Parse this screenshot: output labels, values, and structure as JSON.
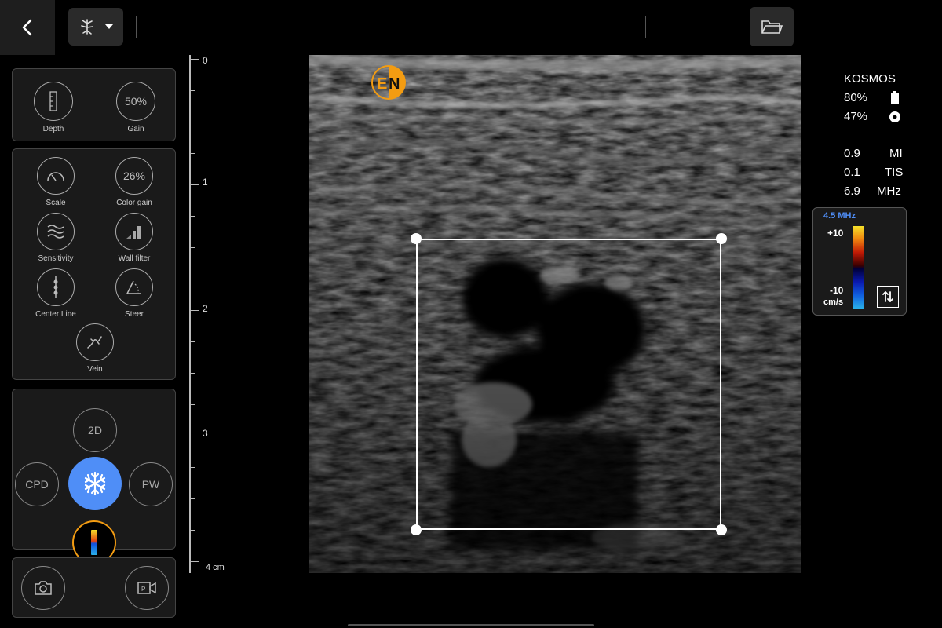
{
  "top_bar": {
    "back_icon": "chevron-left-icon",
    "preset_icon": "vascular-preset-icon",
    "folder_icon": "folder-icon"
  },
  "panel1": {
    "depth": {
      "label": "Depth",
      "icon": "ruler-icon"
    },
    "gain": {
      "label": "Gain",
      "value": "50%"
    }
  },
  "panel2": {
    "scale": {
      "label": "Scale",
      "icon": "gauge-icon"
    },
    "color_gain": {
      "label": "Color gain",
      "value": "26%"
    },
    "sensitivity": {
      "label": "Sensitivity",
      "icon": "waves-icon"
    },
    "wall_filter": {
      "label": "Wall filter",
      "icon": "signal-bars-icon"
    },
    "center_line": {
      "label": "Center Line",
      "icon": "center-line-icon"
    },
    "steer": {
      "label": "Steer",
      "icon": "steer-angle-icon"
    },
    "vein": {
      "label": "Vein",
      "icon": "vein-icon"
    }
  },
  "modes": {
    "mode_2d": "2D",
    "cpd": "CPD",
    "pw": "PW",
    "freeze_icon": "snowflake-icon",
    "color_icon": "color-doppler-icon"
  },
  "capture": {
    "camera_icon": "camera-icon",
    "video_icon": "video-record-icon"
  },
  "depth_scale": {
    "ticks": [
      "0",
      "1",
      "2",
      "3",
      "4 cm"
    ]
  },
  "logo": {
    "text": "EN"
  },
  "info": {
    "device": "KOSMOS",
    "battery": "80%",
    "battery_icon": "battery-icon",
    "probe": "47%",
    "probe_icon": "probe-temp-icon",
    "mi_value": "0.9",
    "mi_label": "MI",
    "tis_value": "0.1",
    "tis_label": "TIS",
    "freq_value": "6.9",
    "freq_label": "MHz"
  },
  "color_scale": {
    "freq": "4.5 MHz",
    "max": "+10",
    "min": "-10",
    "unit": "cm/s",
    "invert_icon": "invert-arrows-icon"
  },
  "colors": {
    "accent_blue": "#4f8ef7",
    "accent_orange": "#f39c12",
    "velocity_bar_top": "#f5e12a",
    "velocity_bar_bottom": "#2ab0e8"
  }
}
